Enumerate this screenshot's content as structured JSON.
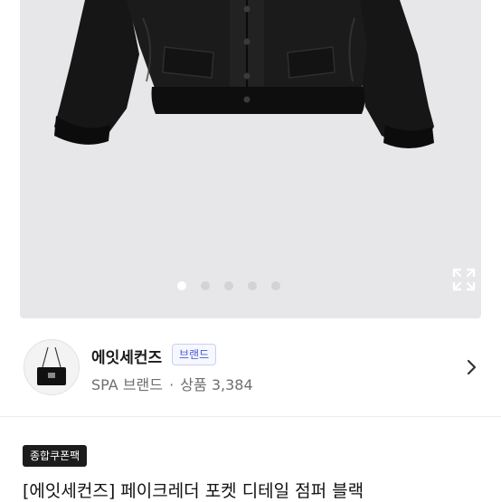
{
  "gallery": {
    "image_alt": "black faux leather jumper",
    "slide_count": 5,
    "active_slide": 1,
    "expand_icon": "expand-icon"
  },
  "brand": {
    "name": "에잇세컨즈",
    "badge": "브랜드",
    "category": "SPA 브랜드",
    "separator": "·",
    "products_label": "상품",
    "products_count": "3,384",
    "thumb_icon": "handbag-icon",
    "chevron_icon": "chevron-right-icon"
  },
  "product": {
    "coupon_label": "종합쿠폰팩",
    "title": "[에잇세컨즈] 페이크레더 포켓 디테일 점퍼  블랙"
  }
}
